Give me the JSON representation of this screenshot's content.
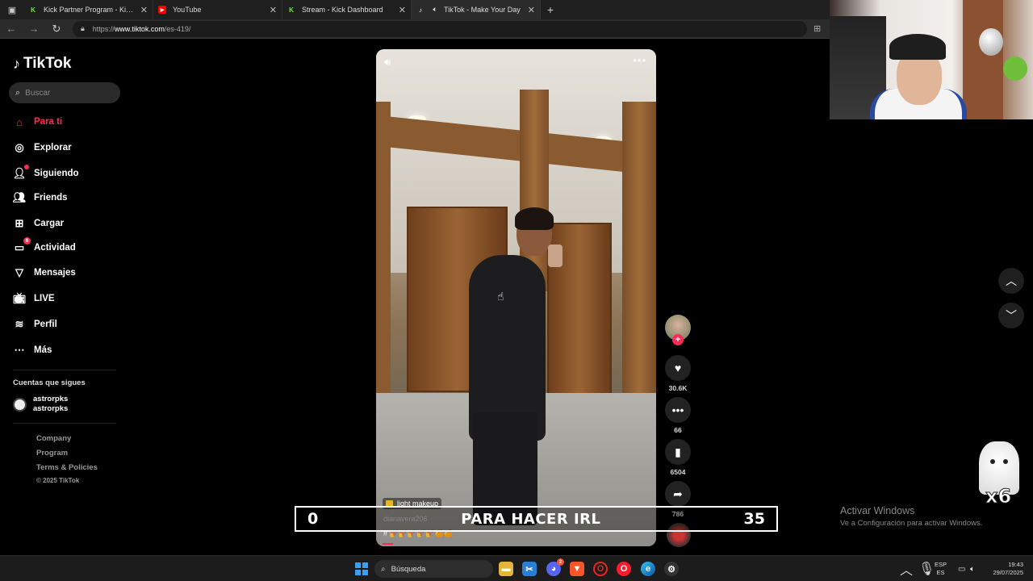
{
  "browser": {
    "tabs": [
      {
        "title": "Kick Partner Program - Kick Dash",
        "favicon": "kick-icon",
        "color": "#53fc18"
      },
      {
        "title": "YouTube",
        "favicon": "youtube-icon",
        "color": "#ff0000"
      },
      {
        "title": "Stream - Kick Dashboard",
        "favicon": "kick-icon",
        "color": "#53fc18"
      },
      {
        "title": "TikTok - Make Your Day",
        "favicon": "tiktok-icon",
        "color": "#ffffff"
      }
    ],
    "url_prefix": "https://",
    "url_host": "www.tiktok.com",
    "url_path": "/es-419/"
  },
  "sidebar": {
    "logo": "TikTok",
    "search_placeholder": "Buscar",
    "nav": [
      {
        "label": "Para ti",
        "icon": "home-icon"
      },
      {
        "label": "Explorar",
        "icon": "compass-icon"
      },
      {
        "label": "Siguiendo",
        "icon": "following-icon"
      },
      {
        "label": "Friends",
        "icon": "friends-icon"
      },
      {
        "label": "Cargar",
        "icon": "upload-icon"
      },
      {
        "label": "Actividad",
        "icon": "activity-icon",
        "badge": "6"
      },
      {
        "label": "Mensajes",
        "icon": "messages-icon"
      },
      {
        "label": "LIVE",
        "icon": "live-icon"
      },
      {
        "label": "Perfil",
        "icon": "profile-icon"
      },
      {
        "label": "Más",
        "icon": "more-icon"
      }
    ],
    "following_title": "Cuentas que sigues",
    "following": [
      {
        "name": "astrorpks",
        "handle": "astrorpks"
      }
    ],
    "footer": [
      "Company",
      "Program",
      "Terms & Policies"
    ],
    "copyright": "© 2025 TikTok"
  },
  "video": {
    "music_chip": "light makeup",
    "username": "dianavera206",
    "tags": "# 💅💅💅💅💅🍊🍊",
    "progress": 0.04
  },
  "actions": {
    "likes": "30.6K",
    "comments": "66",
    "saves": "6504",
    "shares": "786"
  },
  "overlay": {
    "left_count": "0",
    "message": "PARA HACER IRL",
    "right_count": "35"
  },
  "sticker": {
    "multiplier": "x6"
  },
  "watermark": {
    "title": "Activar Windows",
    "subtitle": "Ve a Configuración para activar Windows."
  },
  "taskbar": {
    "search": "Búsqueda",
    "lang_top": "ESP",
    "lang_bottom": "ES",
    "time": "19:43",
    "date": "29/07/2025",
    "discord_badge": "2"
  }
}
